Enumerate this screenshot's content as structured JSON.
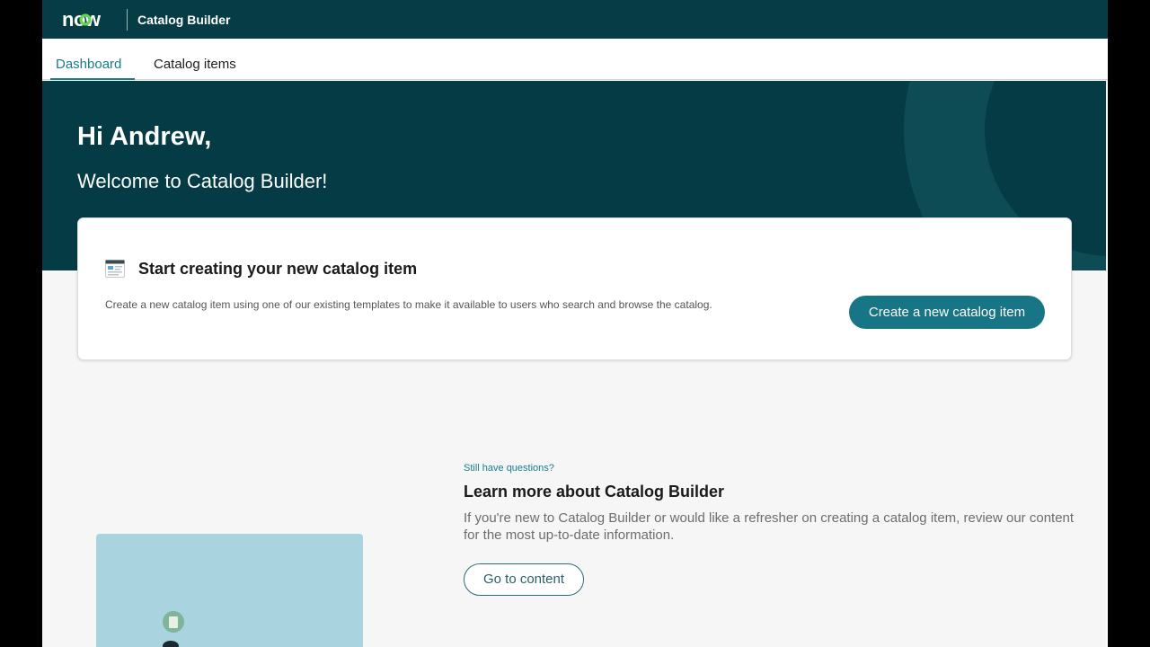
{
  "header": {
    "logo_text": "now",
    "app_title": "Catalog Builder"
  },
  "tabs": [
    {
      "label": "Dashboard",
      "active": true
    },
    {
      "label": "Catalog items",
      "active": false
    }
  ],
  "hero": {
    "greeting": "Hi Andrew,",
    "welcome": "Welcome to Catalog Builder!"
  },
  "card": {
    "icon": "catalog-item-icon",
    "title": "Start creating your new catalog item",
    "description": "Create a new catalog item using one of our existing templates to make it available to users who search and browse the catalog.",
    "button_label": "Create a new catalog item"
  },
  "learn": {
    "eyebrow": "Still have questions?",
    "title": "Learn more about Catalog Builder",
    "description": "If you're new to Catalog Builder or would like a refresher on creating a catalog item, review our content for the most up-to-date information.",
    "button_label": "Go to content"
  },
  "colors": {
    "header_bg": "#063c46",
    "hero_bg": "#043b45",
    "accent": "#197d89",
    "primary_button": "#177585",
    "illustration_bg": "#a9d3de"
  }
}
